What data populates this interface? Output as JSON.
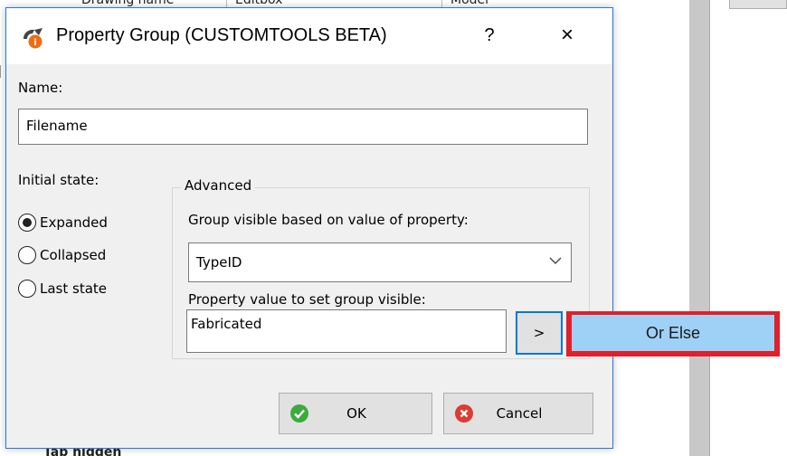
{
  "background": {
    "grid_headers": [
      "Drawing name",
      "Editbox",
      "Model"
    ],
    "bottom_text": "Tab hidden"
  },
  "dialog": {
    "title": "Property Group (CUSTOMTOOLS BETA)",
    "help_label": "?",
    "close_label": "×",
    "app_icon": "customtools-logo-icon",
    "name_label": "Name:",
    "name_value": "Filename",
    "initial_state_label": "Initial state:",
    "states": [
      {
        "label": "Expanded",
        "checked": true
      },
      {
        "label": "Collapsed",
        "checked": false
      },
      {
        "label": "Last state",
        "checked": false
      }
    ],
    "advanced": {
      "legend": "Advanced",
      "visible_label": "Group visible based on value of property:",
      "property_selected": "TypeID",
      "value_label": "Property value to set group visible:",
      "value_text": "Fabricated",
      "add_button_label": ">",
      "or_else_label": "Or Else"
    },
    "ok_label": "OK",
    "cancel_label": "Cancel"
  },
  "colors": {
    "accent": "#0078d7",
    "highlight_border": "#e0202a",
    "or_else_bg": "#9fd0f6"
  }
}
